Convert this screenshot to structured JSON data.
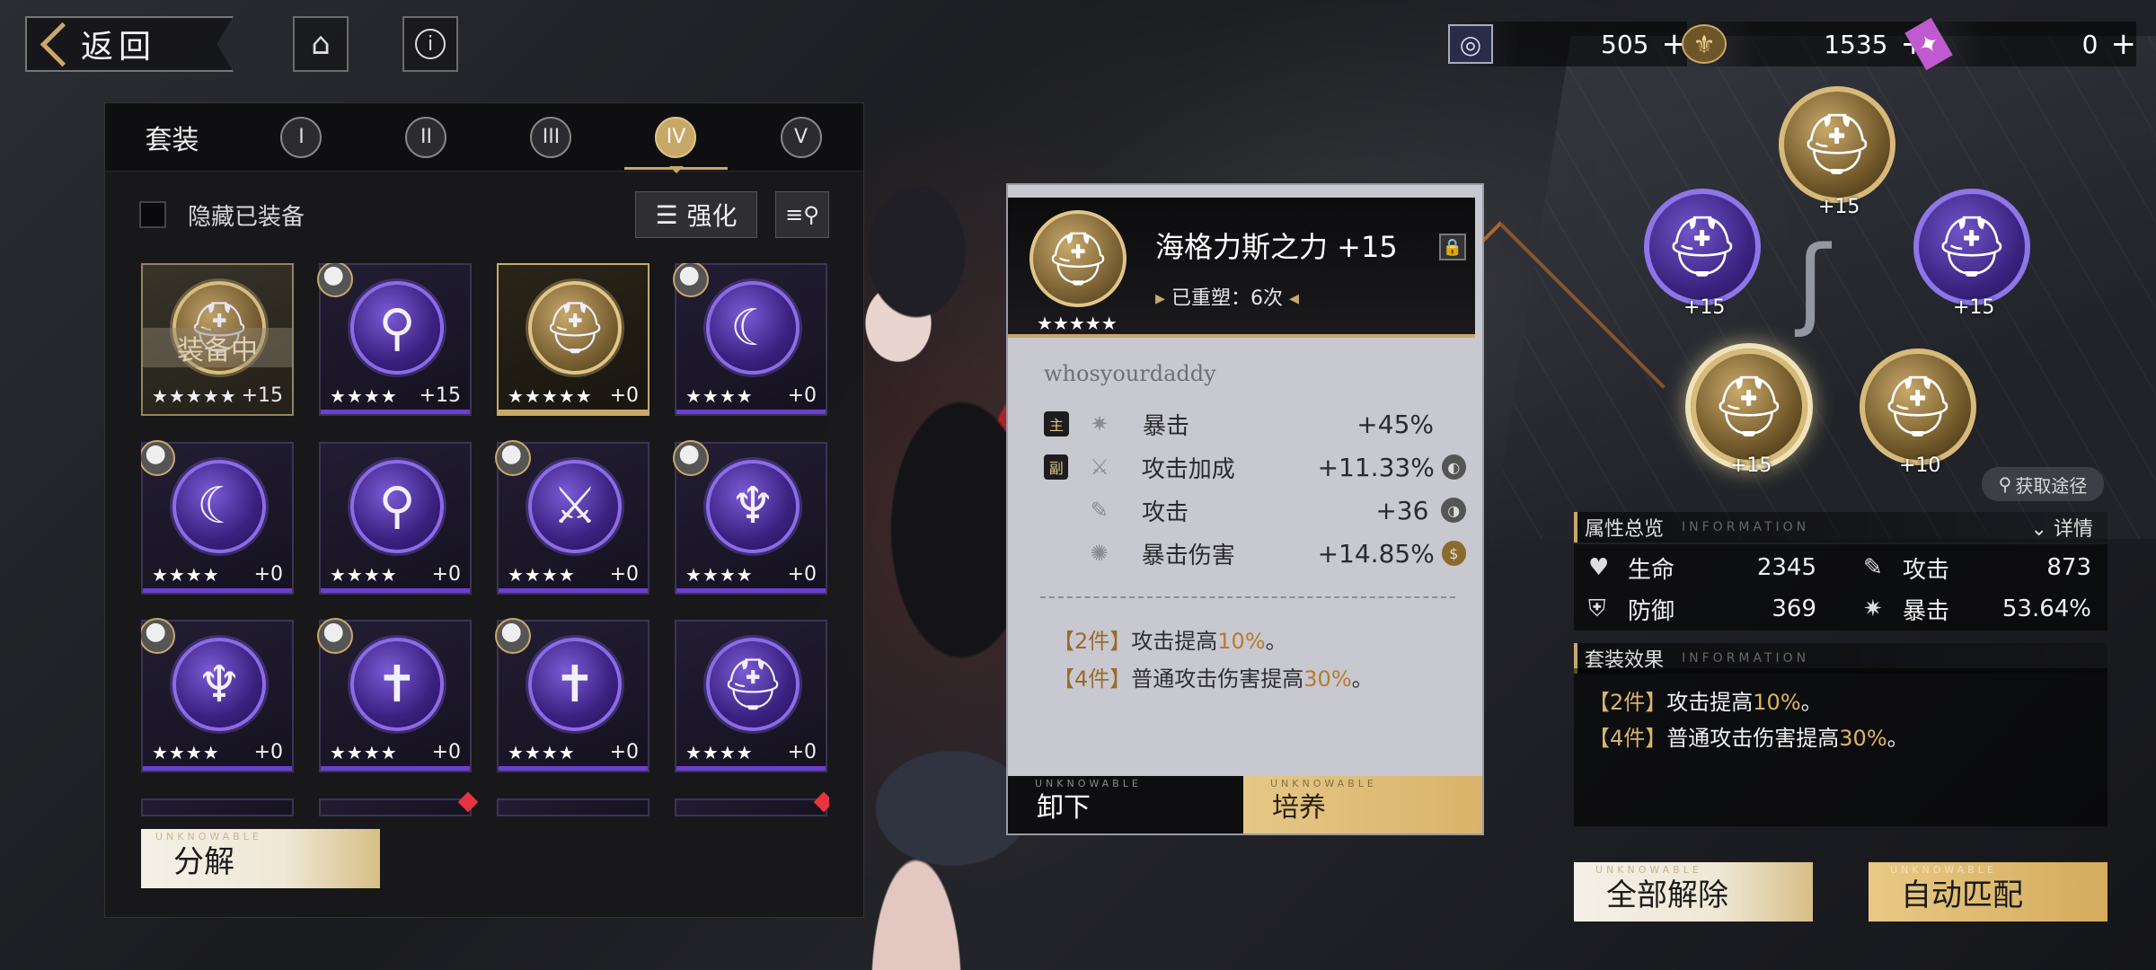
{
  "topbar": {
    "back_label": "返回",
    "home_icon": "home-icon",
    "info_icon": "info-icon",
    "currencies": [
      {
        "icon": "currency-ring-icon",
        "value": "505"
      },
      {
        "icon": "currency-fleur-icon",
        "value": "1535"
      },
      {
        "icon": "currency-ticket-icon",
        "value": "0"
      }
    ],
    "plus": "+"
  },
  "inventory": {
    "set_label": "套装",
    "tabs": [
      {
        "label": "I",
        "active": false
      },
      {
        "label": "II",
        "active": false
      },
      {
        "label": "III",
        "active": false
      },
      {
        "label": "IV",
        "active": true
      },
      {
        "label": "V",
        "active": false
      }
    ],
    "hide_equipped_label": "隐藏已装备",
    "enhance_label": "强化",
    "equipped_badge": "装备中",
    "items": [
      {
        "stars": "★★★★★",
        "level": "+15",
        "equipped": true,
        "rarity": "gold",
        "glyph": "⛑",
        "owner": false
      },
      {
        "stars": "★★★★",
        "level": "+15",
        "rarity": "purple",
        "glyph": "⚲",
        "owner": true
      },
      {
        "stars": "★★★★★",
        "level": "+0",
        "rarity": "gold",
        "glyph": "⛑",
        "owner": false
      },
      {
        "stars": "★★★★",
        "level": "+0",
        "rarity": "purple",
        "glyph": "☾",
        "owner": true
      },
      {
        "stars": "★★★★",
        "level": "+0",
        "rarity": "purple",
        "glyph": "☾",
        "owner": true
      },
      {
        "stars": "★★★★",
        "level": "+0",
        "rarity": "purple",
        "glyph": "⚲",
        "owner": false
      },
      {
        "stars": "★★★★",
        "level": "+0",
        "rarity": "purple",
        "glyph": "⚔",
        "owner": true
      },
      {
        "stars": "★★★★",
        "level": "+0",
        "rarity": "purple",
        "glyph": "♆",
        "owner": true
      },
      {
        "stars": "★★★★",
        "level": "+0",
        "rarity": "purple",
        "glyph": "♆",
        "owner": true
      },
      {
        "stars": "★★★★",
        "level": "+0",
        "rarity": "purple",
        "glyph": "✝",
        "owner": true
      },
      {
        "stars": "★★★★",
        "level": "+0",
        "rarity": "purple",
        "glyph": "✝",
        "owner": true
      },
      {
        "stars": "★★★★",
        "level": "+0",
        "rarity": "purple",
        "glyph": "⛑",
        "owner": false
      }
    ],
    "decompose_label": "分解",
    "decompose_watermark": "UNKNOWABLE"
  },
  "detail": {
    "name": "海格力斯之力 +15",
    "stars": "★★★★★",
    "reforge": "已重塑：6次",
    "owner": "whosyourdaddy",
    "stats": [
      {
        "tag": "主",
        "name": "暴击",
        "value": "+45%",
        "icon": "crit-icon"
      },
      {
        "tag": "副",
        "name": "攻击加成",
        "value": "+11.33%",
        "icon": "attack-bonus-icon"
      },
      {
        "tag": "",
        "name": "攻击",
        "value": "+36",
        "icon": "attack-icon"
      },
      {
        "tag": "",
        "name": "暴击伤害",
        "value": "+14.85%",
        "icon": "crit-damage-icon"
      }
    ],
    "set_effects": [
      {
        "pieces": "【2件】",
        "text": "攻击提高",
        "highlight": "10%",
        "suffix": "。"
      },
      {
        "pieces": "【4件】",
        "text": "普通攻击伤害提高",
        "highlight": "30%",
        "suffix": "。"
      }
    ],
    "unequip_label": "卸下",
    "cultivate_label": "培养",
    "watermark": "UNKNOWABLE"
  },
  "slots": [
    {
      "level": "+15",
      "rarity": "gold",
      "selected": false
    },
    {
      "level": "+15",
      "rarity": "purple",
      "selected": false
    },
    {
      "level": "+15",
      "rarity": "purple",
      "selected": false
    },
    {
      "level": "+15",
      "rarity": "gold",
      "selected": true
    },
    {
      "level": "+10",
      "rarity": "gold",
      "selected": false
    }
  ],
  "get_route_label": "获取途径",
  "attributes": {
    "title": "属性总览",
    "subtitle": "INFORMATION",
    "detail_label": "详情",
    "items": [
      {
        "icon": "heart-icon",
        "name": "生命",
        "value": "2345"
      },
      {
        "icon": "sword-icon",
        "name": "攻击",
        "value": "873"
      },
      {
        "icon": "shield-icon",
        "name": "防御",
        "value": "369"
      },
      {
        "icon": "crit-icon",
        "name": "暴击",
        "value": "53.64%"
      }
    ]
  },
  "set_summary": {
    "title": "套装效果",
    "subtitle": "INFORMATION",
    "effects": [
      {
        "pieces": "【2件】",
        "text": "攻击提高",
        "highlight": "10%",
        "suffix": "。"
      },
      {
        "pieces": "【4件】",
        "text": "普通攻击伤害提高",
        "highlight": "30%",
        "suffix": "。"
      }
    ]
  },
  "buttons": {
    "unequip_all": "全部解除",
    "auto_match": "自动匹配",
    "watermark": "UNKNOWABLE"
  }
}
